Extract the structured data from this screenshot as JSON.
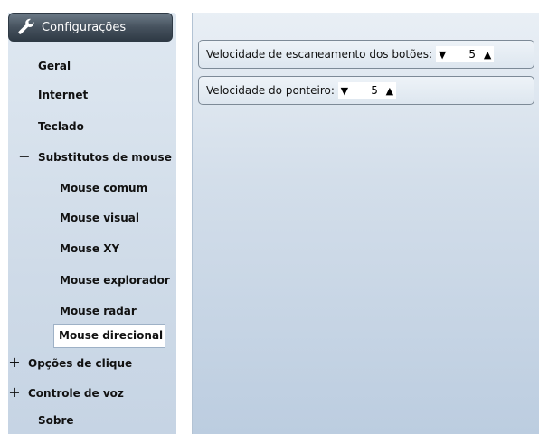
{
  "sidebar": {
    "title": "Configurações",
    "items": [
      {
        "label": "Geral"
      },
      {
        "label": "Internet"
      },
      {
        "label": "Teclado"
      },
      {
        "label": "Substitutos de mouse",
        "mark": "−"
      },
      {
        "label": "Mouse comum"
      },
      {
        "label": "Mouse visual"
      },
      {
        "label": "Mouse XY"
      },
      {
        "label": "Mouse explorador"
      },
      {
        "label": "Mouse radar"
      },
      {
        "label": "Mouse direcional"
      },
      {
        "label": "Opções de clique",
        "mark": "+"
      },
      {
        "label": "Controle de voz",
        "mark": "+"
      },
      {
        "label": "Sobre"
      }
    ]
  },
  "settings": [
    {
      "label": "Velocidade de escaneamento dos botões:",
      "value": "5",
      "down": "▼",
      "up": "▲"
    },
    {
      "label": "Velocidade do ponteiro:",
      "value": "5",
      "down": "▼",
      "up": "▲"
    }
  ],
  "colors": {
    "header_dark": "#2f3a45",
    "panel_bg": "#d3deea",
    "selected_bg": "#ffffff"
  }
}
